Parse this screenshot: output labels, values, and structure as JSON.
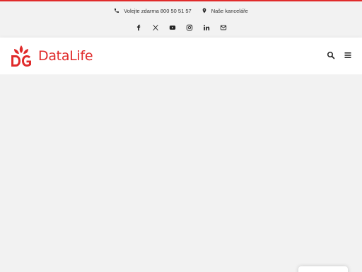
{
  "topbar": {
    "phone_text": "Volejte zdarma 800 50 51 57",
    "offices_text": "Naše kanceláře",
    "social_icons": [
      "facebook-icon",
      "x-twitter-icon",
      "youtube-icon",
      "instagram-icon",
      "linkedin-icon",
      "mail-icon"
    ]
  },
  "header": {
    "logo_text": "DataLife",
    "actions": [
      "search-icon",
      "menu-icon"
    ]
  },
  "colors": {
    "brand_red": "#e02b2b",
    "background": "#f2f2f2",
    "header_bg": "#ffffff"
  }
}
